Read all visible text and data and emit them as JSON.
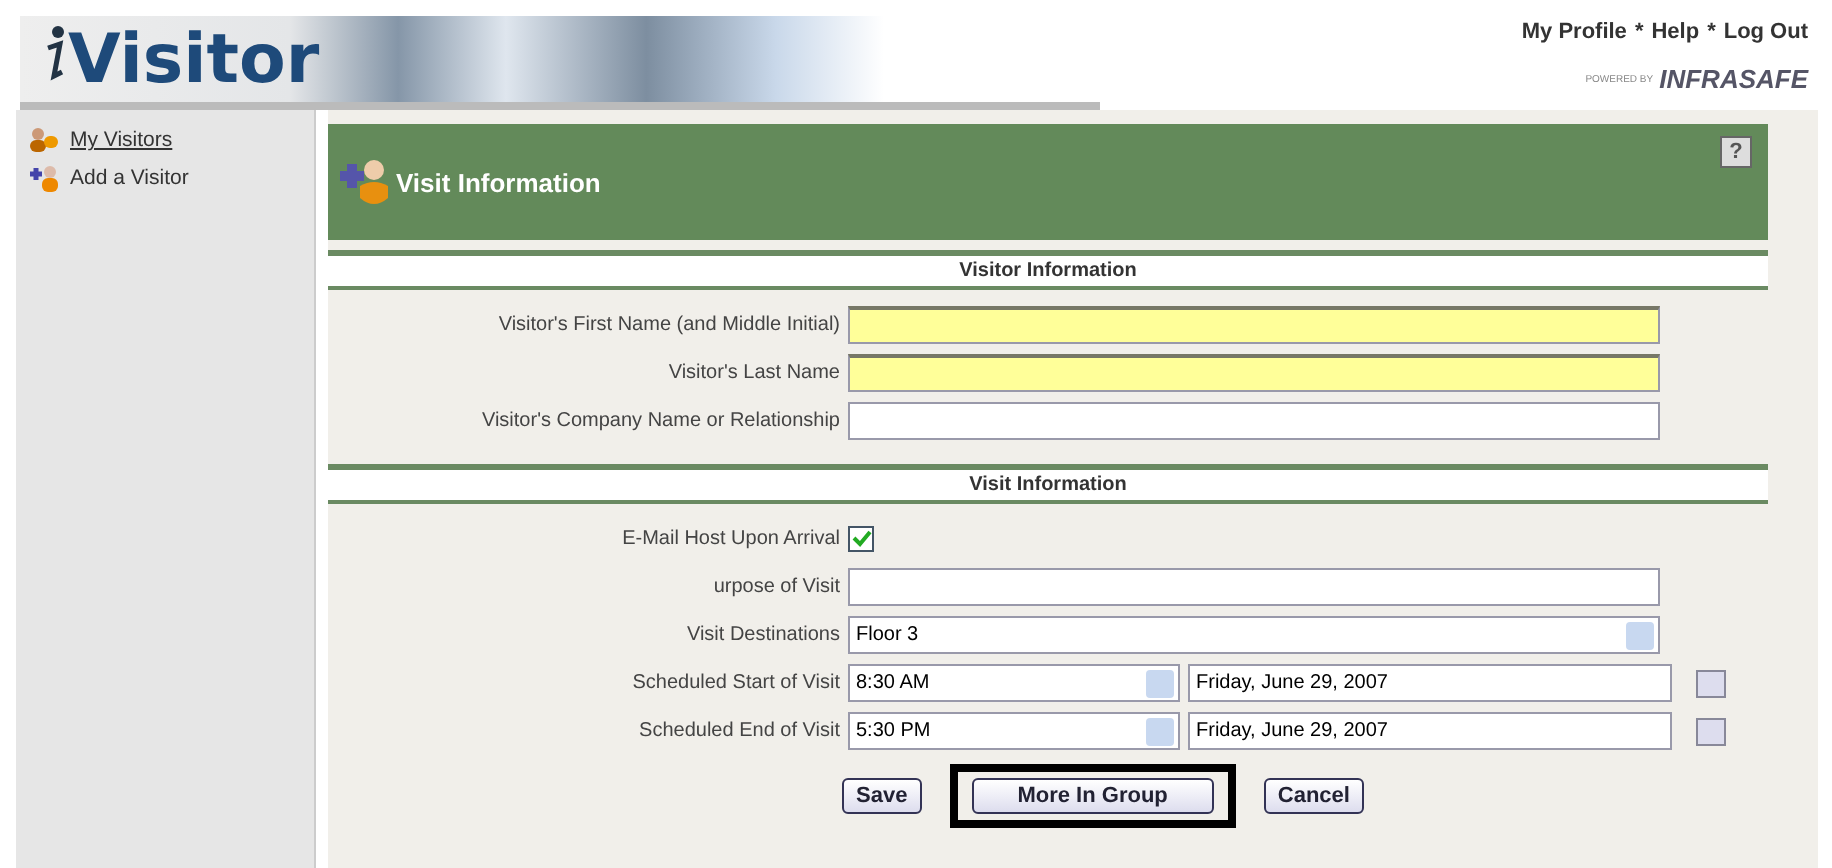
{
  "header": {
    "logo": "Visitor",
    "links": [
      "My Profile",
      "Help",
      "Log Out"
    ],
    "separator": "*",
    "powered_by": "POWERED BY",
    "brand": "INFRASAFE"
  },
  "sidebar": {
    "items": [
      {
        "label": "My Visitors",
        "selected": true
      },
      {
        "label": "Add a Visitor",
        "selected": false
      }
    ]
  },
  "panel": {
    "title": "Visit Information",
    "help": "?"
  },
  "sections": [
    {
      "title": "Visitor Information",
      "fields": [
        {
          "kind": "text",
          "label": "Visitor's First Name (and Middle Initial)",
          "required": true
        },
        {
          "kind": "text",
          "label": "Visitor's Last Name",
          "required": true
        },
        {
          "kind": "text",
          "label": "Visitor's Company Name or Relationship",
          "required": false
        }
      ]
    },
    {
      "title": "Visit Information",
      "fields": [
        {
          "kind": "checkbox",
          "label": "E-Mail Host Upon Arrival",
          "checked": true
        },
        {
          "kind": "text",
          "label": "urpose of Visit",
          "required": false
        },
        {
          "kind": "select",
          "label": "Visit Destinations",
          "value": "Floor 3"
        },
        {
          "kind": "datetime",
          "label": "Scheduled Start of Visit",
          "time": "8:30 AM",
          "date": "Friday, June 29, 2007"
        },
        {
          "kind": "datetime",
          "label": "Scheduled End of Visit",
          "time": "5:30 PM",
          "date": "Friday, June 29, 2007"
        }
      ]
    }
  ],
  "buttons": [
    {
      "label": "Save",
      "highlighted": false
    },
    {
      "label": "More In Group",
      "highlighted": true
    },
    {
      "label": "Cancel",
      "highlighted": false
    }
  ]
}
